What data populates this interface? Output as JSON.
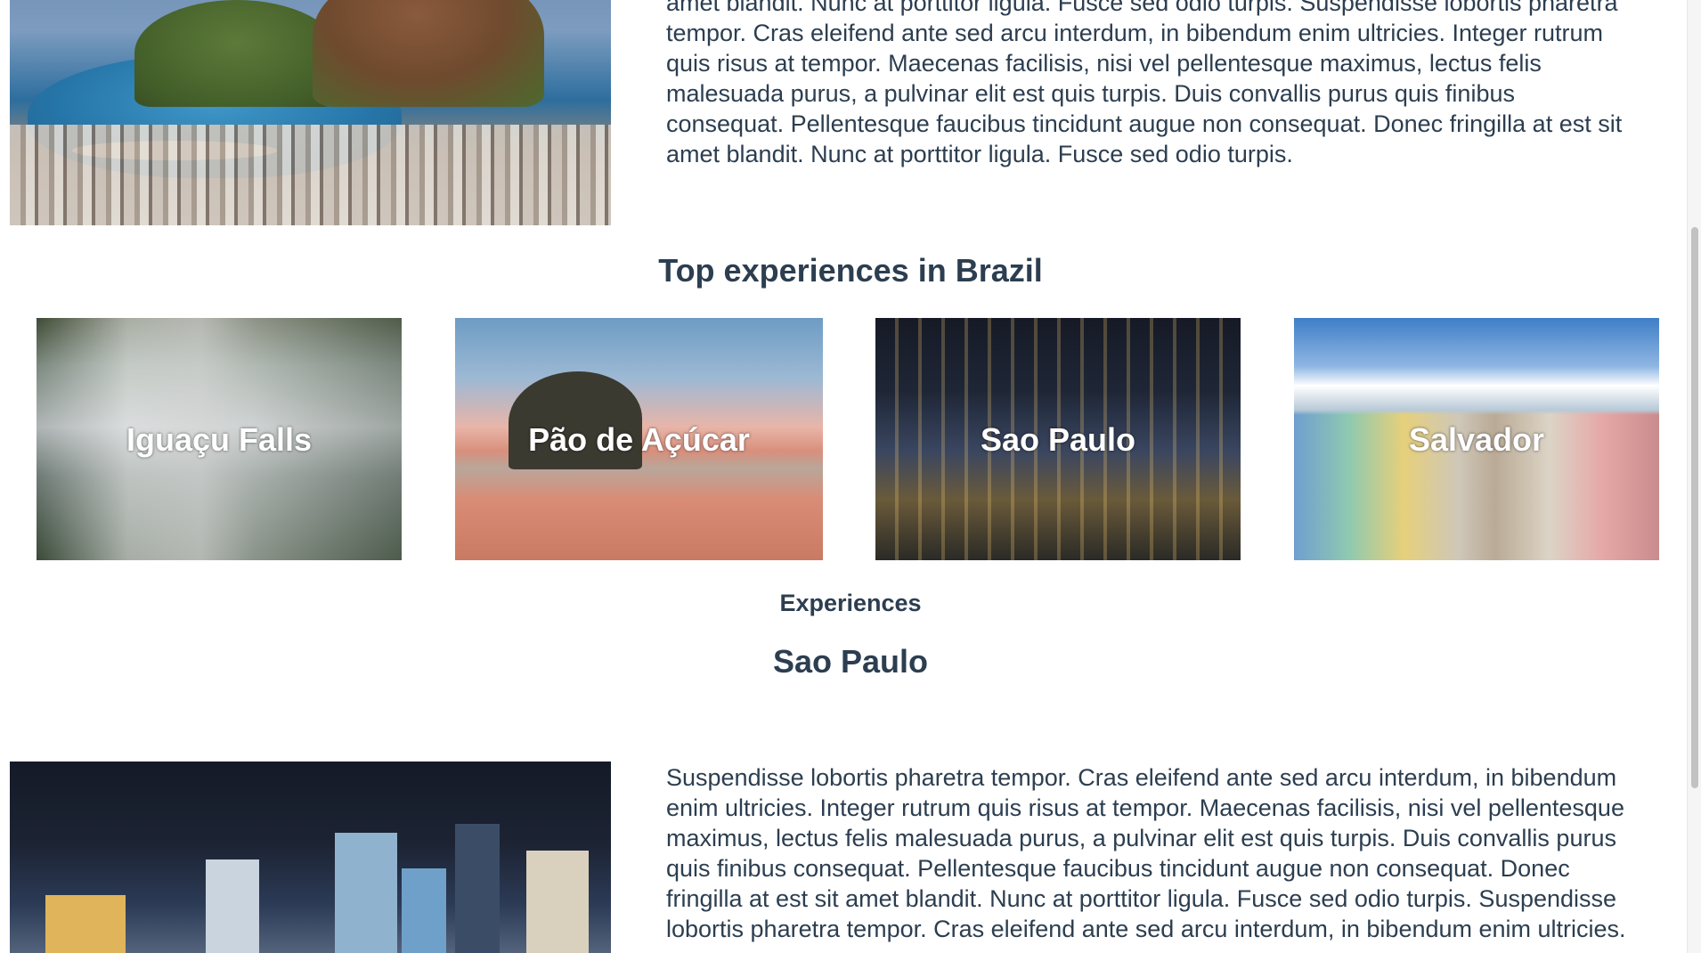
{
  "intro": {
    "image_alt": "Rio de Janeiro bay view",
    "text": "amet blandit. Nunc at porttitor ligula. Fusce sed odio turpis. Suspendisse lobortis pharetra tempor. Cras eleifend ante sed arcu interdum, in bibendum enim ultricies. Integer rutrum quis risus at tempor. Maecenas facilisis, nisi vel pellentesque maximus, lectus felis malesuada purus, a pulvinar elit est quis turpis. Duis convallis purus quis finibus consequat. Pellentesque faucibus tincidunt augue non consequat. Donec fringilla at est sit amet blandit. Nunc at porttitor ligula. Fusce sed odio turpis."
  },
  "top_experiences": {
    "title": "Top experiences in Brazil",
    "cards": [
      {
        "label": "Iguaçu Falls"
      },
      {
        "label": "Pão de Açúcar"
      },
      {
        "label": "Sao Paulo"
      },
      {
        "label": "Salvador"
      }
    ]
  },
  "experiences": {
    "subtitle": "Experiences",
    "city_title": "Sao Paulo",
    "image_alt": "Sao Paulo skyline at night",
    "text": "Suspendisse lobortis pharetra tempor. Cras eleifend ante sed arcu interdum, in bibendum enim ultricies. Integer rutrum quis risus at tempor. Maecenas facilisis, nisi vel pellentesque maximus, lectus felis malesuada purus, a pulvinar elit est quis turpis. Duis convallis purus quis finibus consequat. Pellentesque faucibus tincidunt augue non consequat. Donec fringilla at est sit amet blandit. Nunc at porttitor ligula. Fusce sed odio turpis. Suspendisse lobortis pharetra tempor. Cras eleifend ante sed arcu interdum, in bibendum enim ultricies."
  }
}
